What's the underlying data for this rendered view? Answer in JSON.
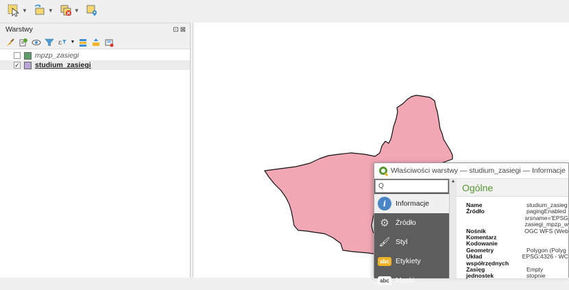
{
  "colors": {
    "polygon_fill": "#f2a7b4",
    "polygon_stroke": "#111111",
    "swatch_mpzp": "#5f9e6a",
    "swatch_studium": "#b7a6d6",
    "qgis_green": "#589632"
  },
  "toolbar": {
    "tools": [
      {
        "icon": "select-features-icon"
      },
      {
        "icon": "identify-features-icon"
      },
      {
        "icon": "deselect-features-icon"
      },
      {
        "icon": "map-tips-icon"
      }
    ]
  },
  "layers_panel": {
    "title": "Warstwy",
    "controls": [
      "⊡",
      "⊠"
    ],
    "tools": [
      "style-manager-icon",
      "add-group-icon",
      "manage-map-themes-icon",
      "filter-legend-icon",
      "filter-by-expression-icon",
      "expand-all-icon",
      "collapse-all-icon",
      "remove-layer-icon"
    ],
    "layers": [
      {
        "name": "mpzp_zasiegi",
        "checked": false,
        "check_mark": ""
      },
      {
        "name": "studium_zasiegi",
        "checked": true,
        "check_mark": "✓"
      }
    ]
  },
  "dialog": {
    "title": "Właściwości warstwy — studium_zasiegi — Informacje",
    "search_glyph": "Q",
    "nav": [
      {
        "label": "Informacje",
        "icon": "info-icon",
        "glyph": "i",
        "active": true
      },
      {
        "label": "Źródło",
        "icon": "source-icon",
        "glyph": "⚙",
        "active": false
      },
      {
        "label": "Styl",
        "icon": "style-icon",
        "glyph": "🖌",
        "active": false
      },
      {
        "label": "Etykiety",
        "icon": "labels-icon",
        "glyph": "abc",
        "active": false
      },
      {
        "label": "Maski",
        "icon": "masks-icon",
        "glyph": "abc",
        "active": false
      }
    ],
    "section_title": "Ogólne",
    "info": [
      {
        "key": "Name",
        "value": "studium_zasieg"
      },
      {
        "key": "Źródło",
        "value": "pagingEnabled"
      },
      {
        "key": "",
        "value": "srsname='EPSG"
      },
      {
        "key": "",
        "value": "zasiegi_mpzp_w"
      },
      {
        "key": "Nośnik",
        "value": "OGC WFS (Web"
      },
      {
        "key": "Komentarz",
        "value": ""
      },
      {
        "key": "Kodowanie",
        "value": ""
      },
      {
        "key": "Geometry",
        "value": "Polygon (Polyg"
      },
      {
        "key": "Układ współrzędnych",
        "value": "EPSG:4326 - WC"
      },
      {
        "key": "Zasięg",
        "value": "Empty"
      },
      {
        "key": "jednostek",
        "value": "stopnie"
      }
    ]
  }
}
